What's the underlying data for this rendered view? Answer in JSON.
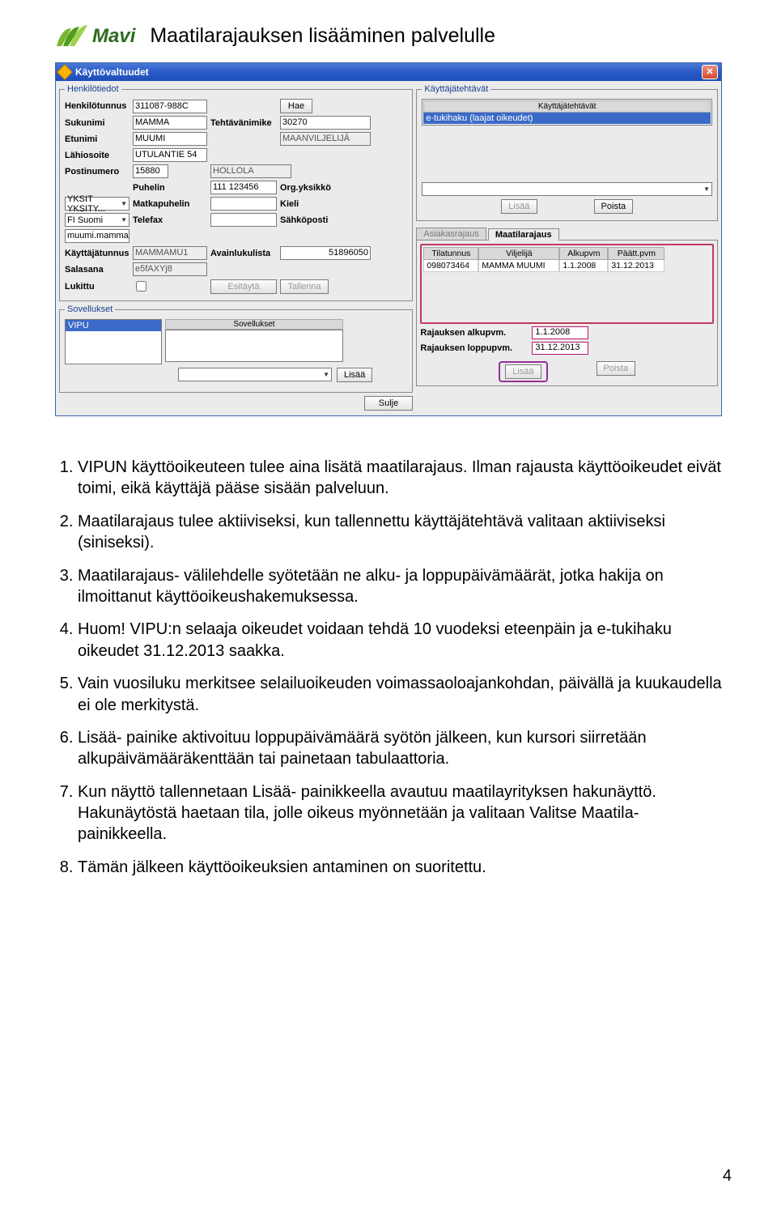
{
  "header": {
    "logo_text": "Mavi",
    "slide_title": "Maatilarajauksen lisääminen palvelulle"
  },
  "window": {
    "title": "Käyttövaltuudet",
    "groups": {
      "henkilotiedot": {
        "legend": "Henkilötiedot",
        "fields": {
          "henkilotunnus": "Henkilötunnus",
          "henkilotunnus_val": "311087-988C",
          "hae_btn": "Hae",
          "sukunimi": "Sukunimi",
          "sukunimi_val": "MAMMA",
          "tehtavanimike": "Tehtävänimike",
          "tehtavanimike_val": "30270",
          "etunimi": "Etunimi",
          "etunimi_val": "MUUMI",
          "tehtavanimike2_val": "MAANVILJELIJÄ",
          "lahiosoite": "Lähiosoite",
          "lahiosoite_val": "UTULANTIE 54",
          "postinumero": "Postinumero",
          "postinumero_val": "15880",
          "postinumero2_val": "HOLLOLA",
          "puhelin": "Puhelin",
          "puhelin_val": "111 123456",
          "orgyksikko": "Org.yksikkö",
          "orgyksikko_val": "YKSIT  YKSITY...",
          "matkapuhelin": "Matkapuhelin",
          "kieli": "Kieli",
          "kieli_val": "FI  Suomi",
          "telefax": "Telefax",
          "sahkoposti": "Sähköposti",
          "sahkoposti_val": "muumi.mamma@ho",
          "kayttajatunnus": "Käyttäjätunnus",
          "kayttajatunnus_val": "MAMMAMU1",
          "avainlukulista": "Avainlukulista",
          "avainlukulista_val": "51896050",
          "salasana": "Salasana",
          "salasana_val": "e5fAXYj8",
          "lukittu": "Lukittu",
          "esitayta_btn": "Esitäytä",
          "tallenna_btn": "Tallenna"
        }
      },
      "kayttajatehtavat": {
        "legend": "Käyttäjätehtävät",
        "list_header": "Käyttäjätehtävät",
        "list_item": "e-tukihaku (laajat oikeudet)",
        "lisaa_btn": "Lisää",
        "poista_btn": "Poista"
      },
      "tabs": {
        "asiakasrajaus": "Asiakasrajaus",
        "maatilarajaus": "Maatilarajaus"
      },
      "maatilarajaus": {
        "cols": {
          "tilatunnus": "Tilatunnus",
          "viljelija": "Viljelijä",
          "alkupvm": "Alkupvm",
          "paattpvm": "Päätt.pvm"
        },
        "row": {
          "tilatunnus": "098073464",
          "viljelija": "MAMMA MUUMI",
          "alkupvm": "1.1.2008",
          "paattpvm": "31.12.2013"
        },
        "rajaus_alku_lbl": "Rajauksen alkupvm.",
        "rajaus_alku_val": "1.1.2008",
        "rajaus_loppu_lbl": "Rajauksen loppupvm.",
        "rajaus_loppu_val": "31.12.2013",
        "lisaa_btn": "Lisää",
        "poista_btn": "Poista"
      },
      "sovellukset": {
        "legend": "Sovellukset",
        "title": "Sovellukset",
        "item": "VIPU",
        "lisaa_btn": "Lisää"
      }
    },
    "sulje_btn": "Sulje"
  },
  "body": {
    "items": [
      "VIPUN käyttöoikeuteen tulee aina lisätä maatilarajaus. Ilman rajausta käyttöoikeudet eivät toimi, eikä käyttäjä pääse sisään palveluun.",
      "Maatilarajaus tulee aktiiviseksi, kun tallennettu käyttäjätehtävä valitaan aktiiviseksi (siniseksi).",
      "Maatilarajaus- välilehdelle syötetään ne alku- ja loppupäivämäärät, jotka hakija on ilmoittanut käyttöoikeushakemuksessa.",
      "Huom! VIPU:n selaaja oikeudet voidaan tehdä 10 vuodeksi eteenpäin ja e-tukihaku oikeudet 31.12.2013 saakka.",
      "Vain vuosiluku merkitsee selailuoikeuden voimassaoloajankohdan, päivällä ja kuukaudella ei ole merkitystä.",
      "Lisää- painike aktivoituu loppupäivämäärä syötön jälkeen, kun kursori siirretään alkupäivämääräkenttään tai painetaan tabulaattoria.",
      "Kun näyttö tallennetaan Lisää- painikkeella avautuu maatilayrityksen hakunäyttö. Hakunäytöstä haetaan tila, jolle oikeus myönnetään ja valitaan Valitse Maatila- painikkeella.",
      "Tämän jälkeen käyttöoikeuksien antaminen on suoritettu."
    ]
  },
  "page_number": "4"
}
